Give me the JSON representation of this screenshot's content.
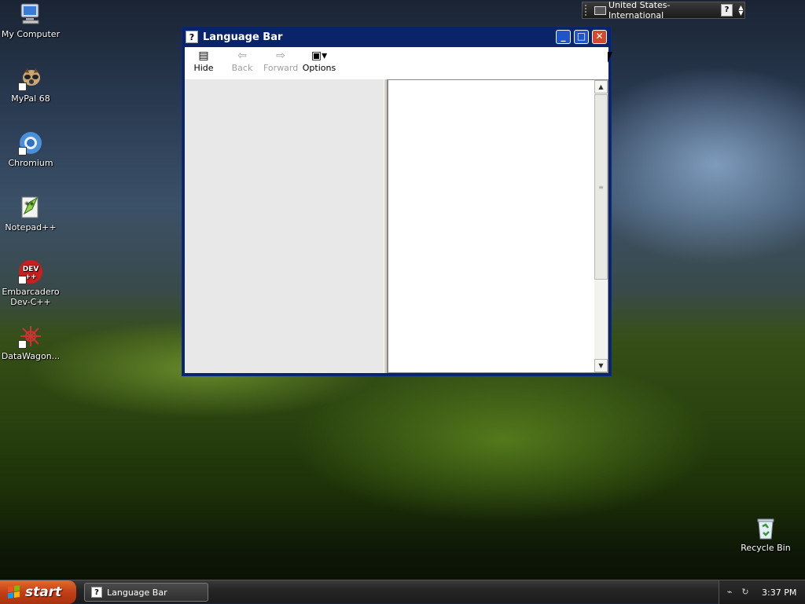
{
  "desktop": {
    "icons": [
      {
        "label": "My Computer",
        "icon": "computer-icon"
      },
      {
        "label": "MyPal 68",
        "icon": "mypal-browser-icon"
      },
      {
        "label": "Chromium",
        "icon": "chromium-icon"
      },
      {
        "label": "Notepad++",
        "icon": "notepadpp-icon"
      },
      {
        "label": "Embarcadero Dev-C++",
        "icon": "devcpp-icon",
        "badge": "DEV\n++"
      },
      {
        "label": "DataWagon...",
        "icon": "datawagon-icon"
      }
    ],
    "recycle_bin": {
      "label": "Recycle Bin",
      "icon": "recycle-bin-icon"
    }
  },
  "language_bar": {
    "language": "United States-International",
    "help_glyph": "?"
  },
  "window": {
    "title": "Language Bar",
    "title_icon_glyph": "?",
    "toolbar": {
      "hide": {
        "label": "Hide",
        "enabled": true
      },
      "back": {
        "label": "Back",
        "enabled": false
      },
      "forward": {
        "label": "Forward",
        "enabled": false
      },
      "options": {
        "label": "Options",
        "enabled": true
      }
    },
    "colors": {
      "titlebar": "#0a246a",
      "close": "#d14a2a"
    }
  },
  "taskbar": {
    "start_label": "start",
    "tasks": [
      {
        "label": "Language Bar"
      }
    ],
    "clock": "3:37 PM"
  }
}
